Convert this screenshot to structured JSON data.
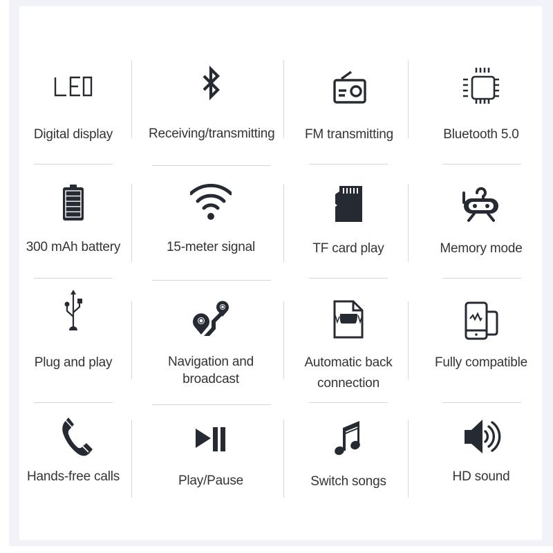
{
  "colors": {
    "icon": "#262a33",
    "text": "#333338",
    "panel_background": "#f2f3f8",
    "card_background": "#ffffff",
    "divider": "#d5d5d8"
  },
  "features": [
    {
      "icon": "led-display-icon",
      "led_text": "LED",
      "label": "Digital display"
    },
    {
      "icon": "bluetooth-icon",
      "label": "Receiving/transmitting"
    },
    {
      "icon": "radio-icon",
      "label": "FM transmitting"
    },
    {
      "icon": "chip-icon",
      "label": "Bluetooth 5.0"
    },
    {
      "icon": "battery-icon",
      "label": "300 mAh battery"
    },
    {
      "icon": "wifi-signal-icon",
      "label": "15-meter signal"
    },
    {
      "icon": "sd-card-icon",
      "label": "TF card play"
    },
    {
      "icon": "robot-icon",
      "label": "Memory mode"
    },
    {
      "icon": "usb-icon",
      "label": "Plug and play"
    },
    {
      "icon": "route-pin-icon",
      "label_line1": "Navigation and",
      "label_line2": "broadcast"
    },
    {
      "icon": "file-icon",
      "label_line1": "Automatic back",
      "label_line2": "connection"
    },
    {
      "icon": "phone-device-icon",
      "label": "Fully compatible"
    },
    {
      "icon": "phone-call-icon",
      "label": "Hands-free calls"
    },
    {
      "icon": "play-pause-icon",
      "label": "Play/Pause"
    },
    {
      "icon": "music-note-icon",
      "label": "Switch songs"
    },
    {
      "icon": "speaker-icon",
      "label": "HD sound"
    }
  ]
}
